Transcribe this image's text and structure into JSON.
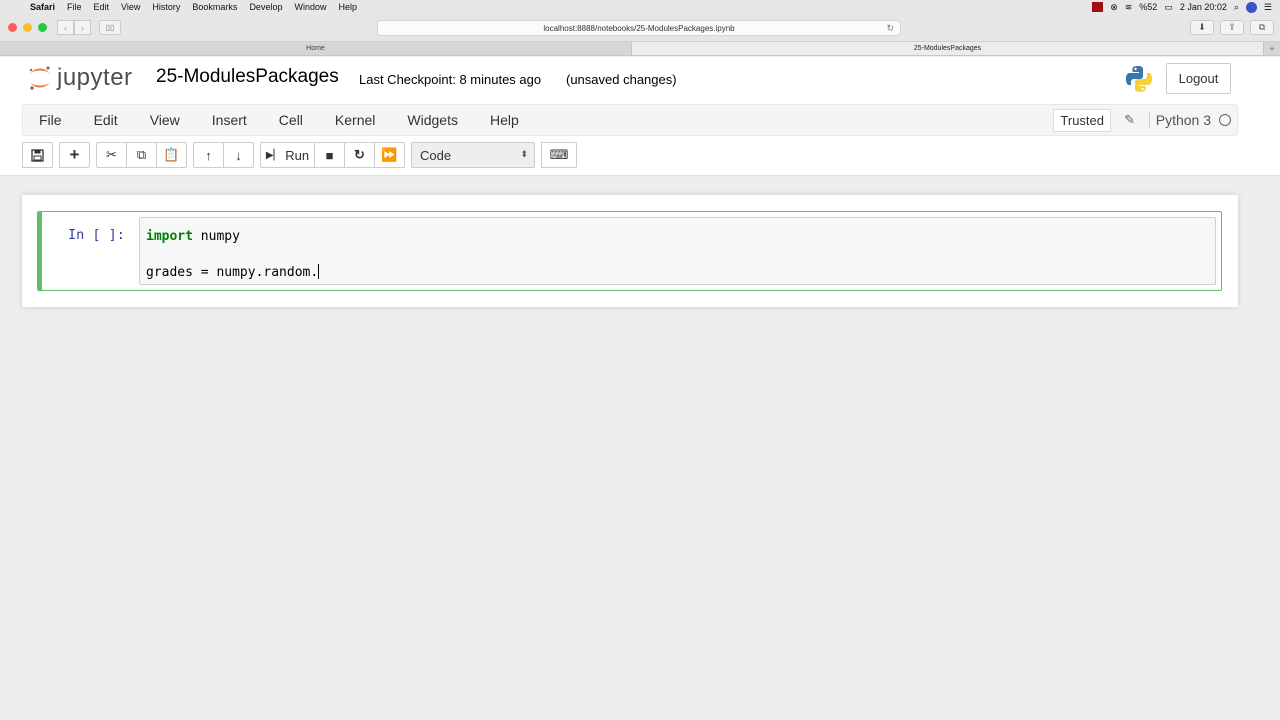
{
  "mac_menu": {
    "app": "Safari",
    "items": [
      "File",
      "Edit",
      "View",
      "History",
      "Bookmarks",
      "Develop",
      "Window",
      "Help"
    ],
    "battery": "%52",
    "datetime": "2 Jan  20:02"
  },
  "browser": {
    "url": "localhost:8888/notebooks/25-ModulesPackages.ipynb",
    "tabs": [
      {
        "title": "Home",
        "active": false
      },
      {
        "title": "25-ModulesPackages",
        "active": true
      }
    ]
  },
  "header": {
    "logo_text": "jupyter",
    "notebook_title": "25-ModulesPackages",
    "checkpoint": "Last Checkpoint: 8 minutes ago",
    "unsaved": "(unsaved changes)",
    "logout": "Logout"
  },
  "menu": {
    "items": [
      "File",
      "Edit",
      "View",
      "Insert",
      "Cell",
      "Kernel",
      "Widgets",
      "Help"
    ],
    "trusted": "Trusted",
    "kernel_name": "Python 3"
  },
  "toolbar": {
    "run_label": "Run",
    "cell_type": "Code"
  },
  "cell": {
    "prompt": "In [ ]:",
    "code_kw": "import",
    "code_line1_rest": " numpy",
    "code_line2": "grades = numpy.random."
  },
  "colors": {
    "cell_border": "#66bb6a",
    "prompt": "#303f9f",
    "keyword": "#008000"
  }
}
